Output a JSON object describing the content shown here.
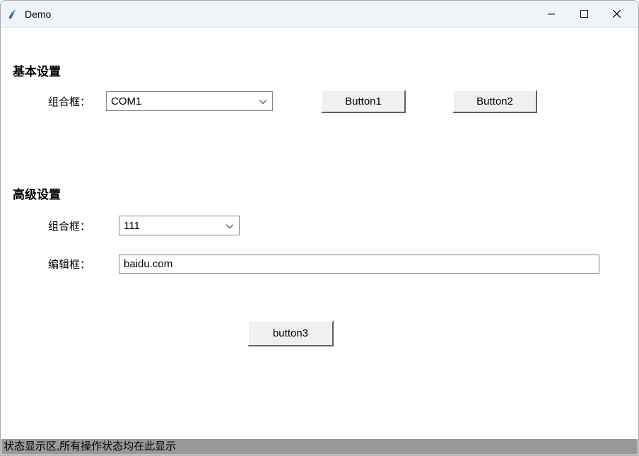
{
  "window": {
    "title": "Demo"
  },
  "section1": {
    "title": "基本设置",
    "combo_label": "组合框：",
    "combo_value": "COM1",
    "button1_label": "Button1",
    "button2_label": "Button2"
  },
  "section2": {
    "title": "高级设置",
    "combo_label": "组合框：",
    "combo_value": "111",
    "edit_label": "编辑框：",
    "edit_value": "baidu.com"
  },
  "button3_label": "button3",
  "statusbar": {
    "text": "状态显示区,所有操作状态均在此显示"
  }
}
